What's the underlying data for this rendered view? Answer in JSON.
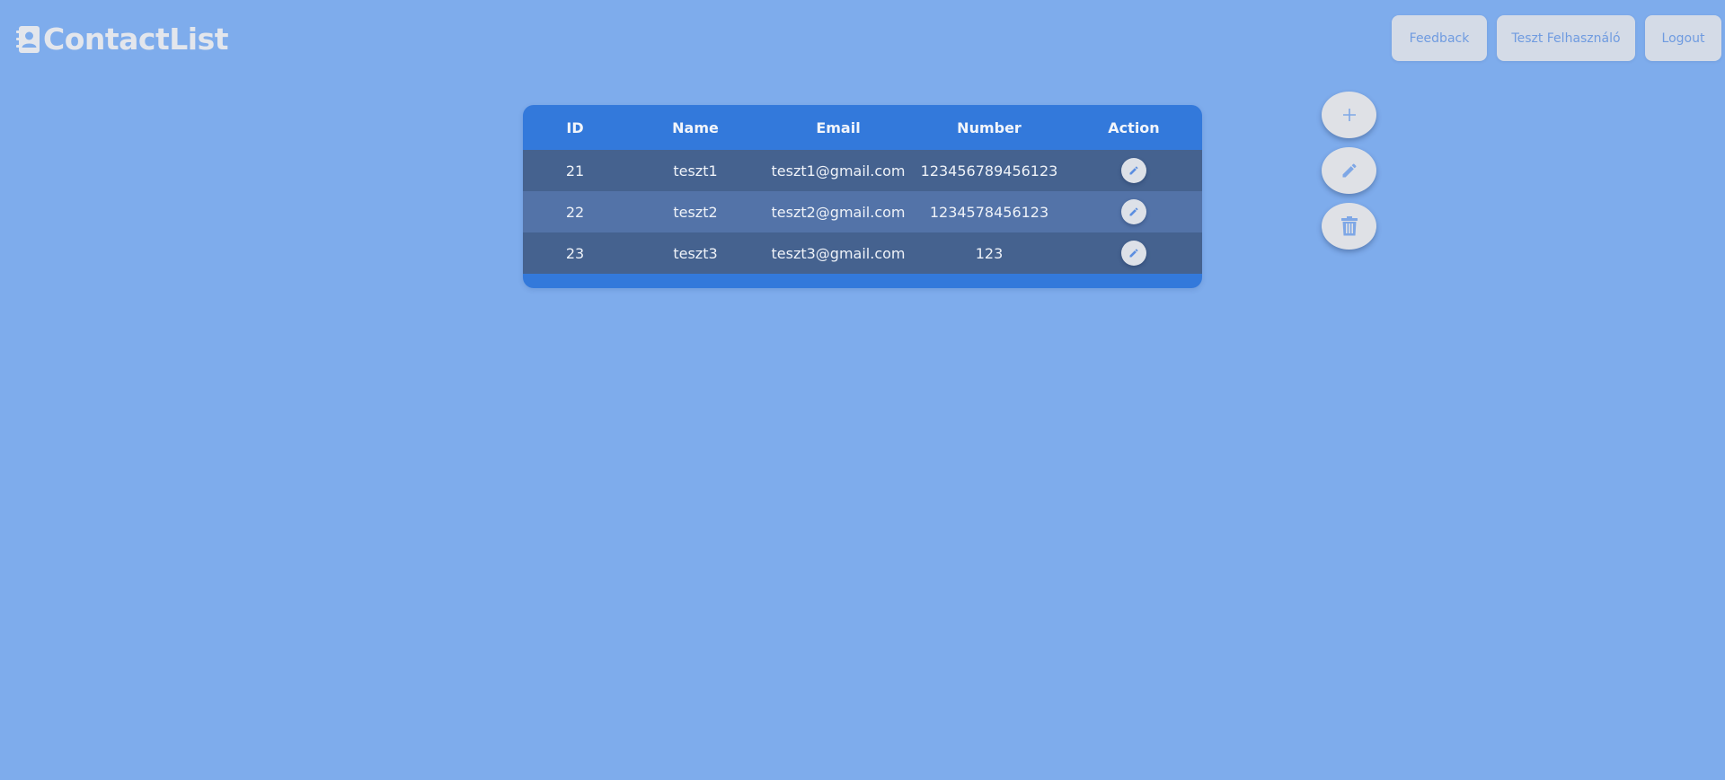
{
  "app": {
    "title": "ContactList",
    "logo_icon": "contact-book-icon"
  },
  "header": {
    "buttons": {
      "feedback": "Feedback",
      "user": "Teszt Felhasználó",
      "logout": "Logout"
    }
  },
  "table": {
    "columns": [
      "ID",
      "Name",
      "Email",
      "Number",
      "Action"
    ],
    "rows": [
      {
        "id": "21",
        "name": "teszt1",
        "email": "teszt1@gmail.com",
        "number": "123456789456123",
        "action_icon": "pencil-icon"
      },
      {
        "id": "22",
        "name": "teszt2",
        "email": "teszt2@gmail.com",
        "number": "1234578456123",
        "action_icon": "pencil-icon"
      },
      {
        "id": "23",
        "name": "teszt3",
        "email": "teszt3@gmail.com",
        "number": "123",
        "action_icon": "pencil-icon"
      }
    ]
  },
  "fabs": [
    {
      "icon": "plus-icon"
    },
    {
      "icon": "pencil-icon"
    },
    {
      "icon": "trash-icon"
    }
  ],
  "colors": {
    "background": "#7eacec",
    "table_header": "#3379db",
    "row_dark": "#45628f",
    "row_light": "#5373a8",
    "button_bg": "#d4dbe7",
    "button_text": "#6f9be0",
    "icon_accent": "#7ea7e6"
  }
}
